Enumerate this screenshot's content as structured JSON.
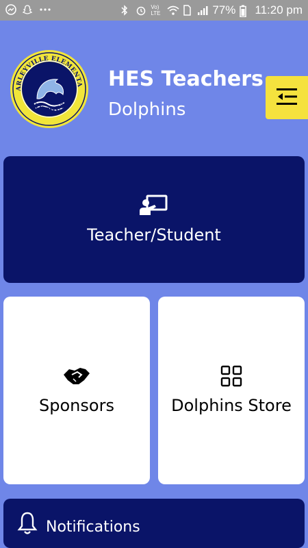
{
  "status_bar": {
    "battery": "77%",
    "time": "11:20 pm",
    "network": "Vo) LTE",
    "icons": [
      "messenger-icon",
      "snapchat-icon",
      "more-icon",
      "bluetooth-icon",
      "alarm-icon",
      "volte-icon",
      "wifi-icon",
      "sim-icon",
      "signal-icon",
      "battery-icon"
    ]
  },
  "header": {
    "title": "HES Teachers",
    "subtitle": "Dolphins",
    "logo": {
      "top_text": "HARLEYVILLE ELEMENTARY",
      "bottom_text": "DOLPHINS"
    },
    "menu_icon": "menu-collapse-icon",
    "menu_color": "#f5e23e"
  },
  "cards": [
    {
      "label": "Teacher/Student",
      "icon": "teacher-board-icon"
    },
    {
      "label": "Sponsors",
      "icon": "handshake-icon"
    },
    {
      "label": "Dolphins Store",
      "icon": "grid-icon"
    }
  ],
  "notifications": {
    "label": "Notifications",
    "icon": "bell-icon"
  },
  "colors": {
    "background": "#6f86e8",
    "primary_card": "#0a1468",
    "secondary_card": "#ffffff",
    "status_bar": "#9a9a9a"
  }
}
